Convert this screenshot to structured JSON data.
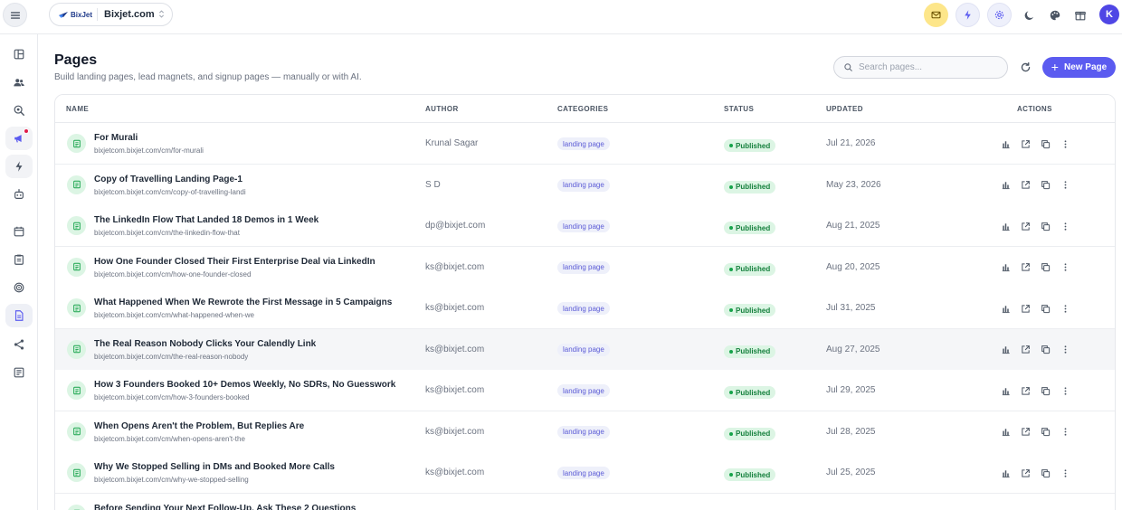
{
  "topbar": {
    "workspace_logo": "BixJet",
    "workspace_name": "Bixjet.com",
    "avatar_initial": "K"
  },
  "header": {
    "title": "Pages",
    "subtitle": "Build landing pages, lead magnets, and signup pages — manually or with AI.",
    "search_placeholder": "Search pages...",
    "new_page_label": "New Page",
    "new_page_icon": "+"
  },
  "table": {
    "columns": {
      "name": "NAME",
      "author": "AUTHOR",
      "categories": "CATEGORIES",
      "status": "STATUS",
      "updated": "UPDATED",
      "actions": "ACTIONS"
    },
    "rows": [
      {
        "title": "For Murali",
        "url": "bixjetcom.bixjet.com/cm/for-murali",
        "author": "Krunal Sagar",
        "category": "landing page",
        "status": "Published",
        "updated": "Jul 21, 2026"
      },
      {
        "title": "Copy of Travelling Landing Page-1",
        "url": "bixjetcom.bixjet.com/cm/copy-of-travelling-landi",
        "author": "S D",
        "category": "landing page",
        "status": "Published",
        "updated": "May 23, 2026"
      },
      {
        "title": "The LinkedIn Flow That Landed 18 Demos in 1 Week",
        "url": "bixjetcom.bixjet.com/cm/the-linkedin-flow-that",
        "author": "dp@bixjet.com",
        "category": "landing page",
        "status": "Published",
        "updated": "Aug 21, 2025"
      },
      {
        "title": "How One Founder Closed Their First Enterprise Deal via LinkedIn",
        "url": "bixjetcom.bixjet.com/cm/how-one-founder-closed",
        "author": "ks@bixjet.com",
        "category": "landing page",
        "status": "Published",
        "updated": "Aug 20, 2025"
      },
      {
        "title": "What Happened When We Rewrote the First Message in 5 Campaigns",
        "url": "bixjetcom.bixjet.com/cm/what-happened-when-we",
        "author": "ks@bixjet.com",
        "category": "landing page",
        "status": "Published",
        "updated": "Jul 31, 2025"
      },
      {
        "title": "The Real Reason Nobody Clicks Your Calendly Link",
        "url": "bixjetcom.bixjet.com/cm/the-real-reason-nobody",
        "author": "ks@bixjet.com",
        "category": "landing page",
        "status": "Published",
        "updated": "Aug 27, 2025"
      },
      {
        "title": "How 3 Founders Booked 10+ Demos Weekly, No SDRs, No Guesswork",
        "url": "bixjetcom.bixjet.com/cm/how-3-founders-booked",
        "author": "ks@bixjet.com",
        "category": "landing page",
        "status": "Published",
        "updated": "Jul 29, 2025"
      },
      {
        "title": "When Opens Aren't the Problem, But Replies Are",
        "url": "bixjetcom.bixjet.com/cm/when-opens-aren't-the",
        "author": "ks@bixjet.com",
        "category": "landing page",
        "status": "Published",
        "updated": "Jul 28, 2025"
      },
      {
        "title": "Why We Stopped Selling in DMs and Booked More Calls",
        "url": "bixjetcom.bixjet.com/cm/why-we-stopped-selling",
        "author": "ks@bixjet.com",
        "category": "landing page",
        "status": "Published",
        "updated": "Jul 25, 2025"
      },
      {
        "title": "Before Sending Your Next Follow-Up, Ask These 2 Questions",
        "url": "",
        "author": "",
        "category": "",
        "status": "",
        "updated": ""
      }
    ]
  },
  "colors": {
    "accent": "#5b5bf0",
    "published_bg": "#dcf5e4",
    "published_text": "#15803d",
    "category_bg": "#eef0fa",
    "category_text": "#5b5bd6",
    "mail_button_bg": "#fde68a"
  },
  "icons": {
    "sidebar": [
      "dashboard-icon",
      "contacts-icon",
      "search-radar-icon",
      "campaigns-icon",
      "automation-icon",
      "bot-icon",
      "calendar-icon",
      "clipboard-icon",
      "target-icon",
      "pages-icon",
      "share-icon",
      "forms-icon"
    ],
    "row_actions": [
      "bar-chart-icon",
      "external-link-icon",
      "copy-icon",
      "more-vertical-icon"
    ]
  }
}
